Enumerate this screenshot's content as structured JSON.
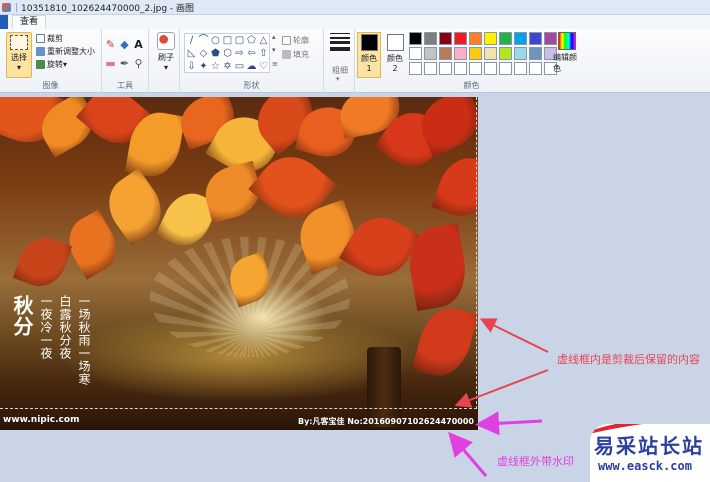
{
  "window": {
    "title": "10351810_102624470000_2.jpg - 画图"
  },
  "menu": {
    "tabs": [
      {
        "label": "查看"
      }
    ]
  },
  "ribbon": {
    "image_group": {
      "label": "图像",
      "select": "选择",
      "crop": "裁剪",
      "resize": "重新调整大小",
      "rotate": "旋转"
    },
    "tools_group": {
      "label": "工具"
    },
    "brush": {
      "label": "刷子"
    },
    "shapes_group": {
      "label": "形状",
      "outline": "轮廓",
      "fill": "填充"
    },
    "size": {
      "label": "粗细"
    },
    "colors_group": {
      "label": "颜色",
      "color1": "颜色 1",
      "color2": "颜色 2",
      "edit": "编辑颜色",
      "color1_value": "#000000",
      "color2_value": "#ffffff",
      "palette": [
        "#000000",
        "#7f7f7f",
        "#880015",
        "#ed1c24",
        "#ff7f27",
        "#fff200",
        "#22b14c",
        "#00a2e8",
        "#3f48cc",
        "#a349a4",
        "#ffffff",
        "#c3c3c3",
        "#b97a57",
        "#ffaec9",
        "#ffc90e",
        "#efe4b0",
        "#b5e61d",
        "#99d9ea",
        "#7092be",
        "#c8bfe7",
        "#ffffff",
        "#ffffff",
        "#ffffff",
        "#ffffff",
        "#ffffff",
        "#ffffff",
        "#ffffff",
        "#ffffff",
        "#ffffff",
        "#ffffff"
      ]
    }
  },
  "canvas": {
    "poem_columns": [
      "一场秋雨一场寒",
      "白露秋分夜",
      "一夜冷一夜"
    ],
    "poem_title": "秋分",
    "watermark_left": "www.nipic.com",
    "watermark_right": "By:凡客宝佳 No:20160907102624470000"
  },
  "annotations": {
    "inside_crop": "虚线框内是剪裁后保留的内容",
    "outside_crop": "虚线框外带水印"
  },
  "logo": {
    "name": "易采站长站",
    "url": "www.easck.com"
  }
}
